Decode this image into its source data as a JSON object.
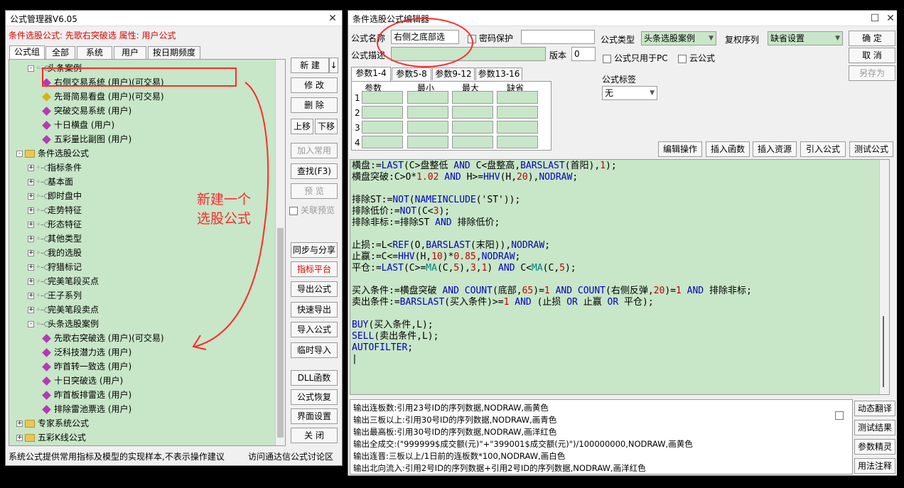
{
  "left_window": {
    "title": "公式管理器V6.05",
    "header_text": "条件选股公式: 先歌右突破选  属性: 用户公式",
    "tabs": [
      "公式组",
      "全部",
      "系统",
      "用户",
      "按日期频度"
    ],
    "tree": [
      {
        "label": "头条案例",
        "level": 2,
        "type": "group"
      },
      {
        "label": "右侧交易系统 (用户)(可交易)",
        "level": 3,
        "type": "formula"
      },
      {
        "label": "先哥简易看盘 (用户)(可交易)",
        "level": 3,
        "type": "formula-y"
      },
      {
        "label": "突破交易系统 (用户)",
        "level": 3,
        "type": "formula"
      },
      {
        "label": "十日横盘 (用户)",
        "level": 3,
        "type": "formula"
      },
      {
        "label": "五彩量比副图 (用户)",
        "level": 3,
        "type": "formula"
      },
      {
        "label": "条件选股公式",
        "level": 0,
        "type": "folder"
      },
      {
        "label": "指标条件",
        "level": 1,
        "type": "group"
      },
      {
        "label": "基本面",
        "level": 1,
        "type": "group"
      },
      {
        "label": "即时盘中",
        "level": 1,
        "type": "group"
      },
      {
        "label": "走势特征",
        "level": 1,
        "type": "group"
      },
      {
        "label": "形态特征",
        "level": 1,
        "type": "group"
      },
      {
        "label": "其他类型",
        "level": 1,
        "type": "group"
      },
      {
        "label": "我的选股",
        "level": 1,
        "type": "group"
      },
      {
        "label": "狩猎标记",
        "level": 1,
        "type": "group"
      },
      {
        "label": "完美笔段买点",
        "level": 1,
        "type": "group"
      },
      {
        "label": "王子系列",
        "level": 1,
        "type": "group"
      },
      {
        "label": "完美笔段卖点",
        "level": 1,
        "type": "group"
      },
      {
        "label": "头条选股案例",
        "level": 1,
        "type": "group-open"
      },
      {
        "label": "先歌右突破选 (用户)(可交易)",
        "level": 3,
        "type": "formula"
      },
      {
        "label": "泛科技潜力选 (用户)",
        "level": 3,
        "type": "formula"
      },
      {
        "label": "昨首转一致选 (用户)",
        "level": 3,
        "type": "formula"
      },
      {
        "label": "十日突破选 (用户)",
        "level": 3,
        "type": "formula"
      },
      {
        "label": "昨首板排雷选 (用户)",
        "level": 3,
        "type": "formula"
      },
      {
        "label": "排除雷池票选 (用户)",
        "level": 3,
        "type": "formula"
      },
      {
        "label": "专家系统公式",
        "level": 0,
        "type": "folder"
      },
      {
        "label": "五彩K线公式",
        "level": 0,
        "type": "folder"
      }
    ],
    "buttons": {
      "new": "新 建",
      "new_arrow": "↓",
      "edit": "修 改",
      "delete": "删 除",
      "move_up": "上移",
      "move_down": "下移",
      "add_common": "加入常用",
      "find": "查找(F3)",
      "preview": "预 览",
      "link_preview": "关联预览",
      "sync_share": "同步与分享",
      "indicator_platform": "指标平台",
      "export": "导出公式",
      "quick_export": "快速导出",
      "import": "导入公式",
      "temp_import": "临时导入",
      "dll": "DLL函数",
      "restore": "公式恢复",
      "ui_settings": "界面设置",
      "close": "关 闭"
    },
    "footer_left": "系统公式提供常用指标及模型的实现样本,不表示操作建议",
    "footer_right": "访问通达信公式讨论区"
  },
  "annotation": {
    "line1": "新建一个",
    "line2": "选股公式"
  },
  "right_window": {
    "title": "条件选股公式编辑器",
    "name_label": "公式名称",
    "name_value": "右侧之底部选",
    "password_label": "密码保护",
    "desc_label": "公式描述",
    "version_label": "版本",
    "version_value": "0",
    "type_label": "公式类型",
    "type_value": "头条选股案例",
    "restore_label": "复权序列",
    "restore_value": "缺省设置",
    "pc_only_label": "公式只用于PC",
    "cloud_label": "云公式",
    "tag_label": "公式标签",
    "tag_value": "无",
    "ok": "确 定",
    "cancel": "取 消",
    "save_as": "另存为",
    "param_tabs": [
      "参数1-4",
      "参数5-8",
      "参数9-12",
      "参数13-16"
    ],
    "param_headers": [
      "参数",
      "最小",
      "最大",
      "缺省"
    ],
    "param_rows": [
      "1",
      "2",
      "3",
      "4"
    ],
    "tool_buttons": [
      "编辑操作",
      "插入函数",
      "插入资源",
      "引入公式",
      "测试公式"
    ],
    "output_lines": [
      "输出连板数:引用23号ID的序列数据,NODRAW,画黄色",
      "输出三板以上:引用30号ID的序列数据,NODRAW,画青色",
      "输出最高板:引用30号ID的序列数据,NODRAW,画洋红色",
      "输出全成交:(\"999999$成交额(元)\"+\"399001$成交额(元)\")/100000000,NODRAW,画黄色",
      "输出连晋:三板以上/1日前的连板数*100,NODRAW,画白色",
      "输出北向流入:引用2号ID的序列数据+引用2号ID的序列数据,NODRAW,画洋红色"
    ],
    "side_buttons": [
      "动态翻译",
      "测试结果",
      "参数精灵",
      "用法注释"
    ]
  }
}
